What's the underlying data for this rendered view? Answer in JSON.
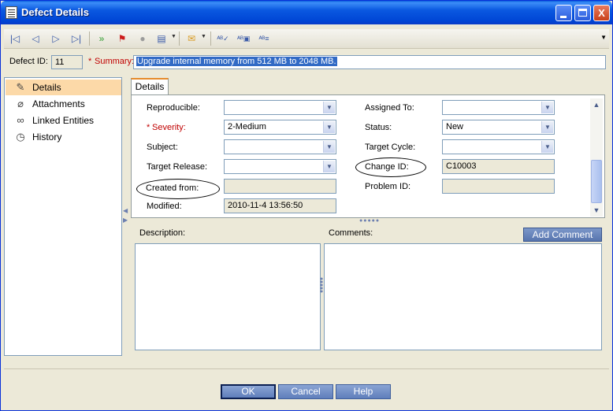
{
  "window": {
    "title": "Defect Details",
    "controls": {
      "minimize": "_",
      "maximize": "□",
      "close": "X"
    }
  },
  "toolbar": {
    "icons": [
      "first-record-icon",
      "previous-record-icon",
      "next-record-icon",
      "last-record-icon",
      "go-to-icon",
      "flag-icon",
      "alert-icon",
      "document-icon",
      "mail-icon",
      "spell-check-icon",
      "spelling-options-icon",
      "thesaurus-icon"
    ]
  },
  "header": {
    "defect_id_label": "Defect ID:",
    "defect_id_value": "11",
    "summary_required": "*",
    "summary_label": "Summary:",
    "summary_value": "Upgrade internal memory from 512 MB to 2048 MB."
  },
  "sidebar": {
    "items": [
      {
        "label": "Details",
        "icon": "details-icon",
        "selected": true
      },
      {
        "label": "Attachments",
        "icon": "paperclip-icon",
        "selected": false
      },
      {
        "label": "Linked Entities",
        "icon": "link-icon",
        "selected": false
      },
      {
        "label": "History",
        "icon": "history-icon",
        "selected": false
      }
    ]
  },
  "tabs": [
    {
      "label": "Details"
    }
  ],
  "fields": {
    "reproducible": {
      "label": "Reproducible:",
      "value": ""
    },
    "severity": {
      "required": "*",
      "label": "Severity:",
      "value": "2-Medium"
    },
    "subject": {
      "label": "Subject:",
      "value": ""
    },
    "target_release": {
      "label": "Target Release:",
      "value": ""
    },
    "created_from": {
      "label": "Created from:",
      "value": ""
    },
    "modified": {
      "label": "Modified:",
      "value": "2010-11-4 13:56:50"
    },
    "assigned_to": {
      "label": "Assigned To:",
      "value": ""
    },
    "status": {
      "label": "Status:",
      "value": "New"
    },
    "target_cycle": {
      "label": "Target Cycle:",
      "value": ""
    },
    "change_id": {
      "label": "Change ID:",
      "value": "C10003"
    },
    "problem_id": {
      "label": "Problem ID:",
      "value": ""
    }
  },
  "memo": {
    "description_label": "Description:",
    "comments_label": "Comments:",
    "add_comment_label": "Add Comment"
  },
  "buttons": {
    "ok": "OK",
    "cancel": "Cancel",
    "help": "Help"
  },
  "colors": {
    "title_bar": "#0a58e0",
    "selection": "#316ac5",
    "sidebar_selected": "#fcd9a8",
    "required": "#c00000",
    "button": "#6f8cc3"
  }
}
